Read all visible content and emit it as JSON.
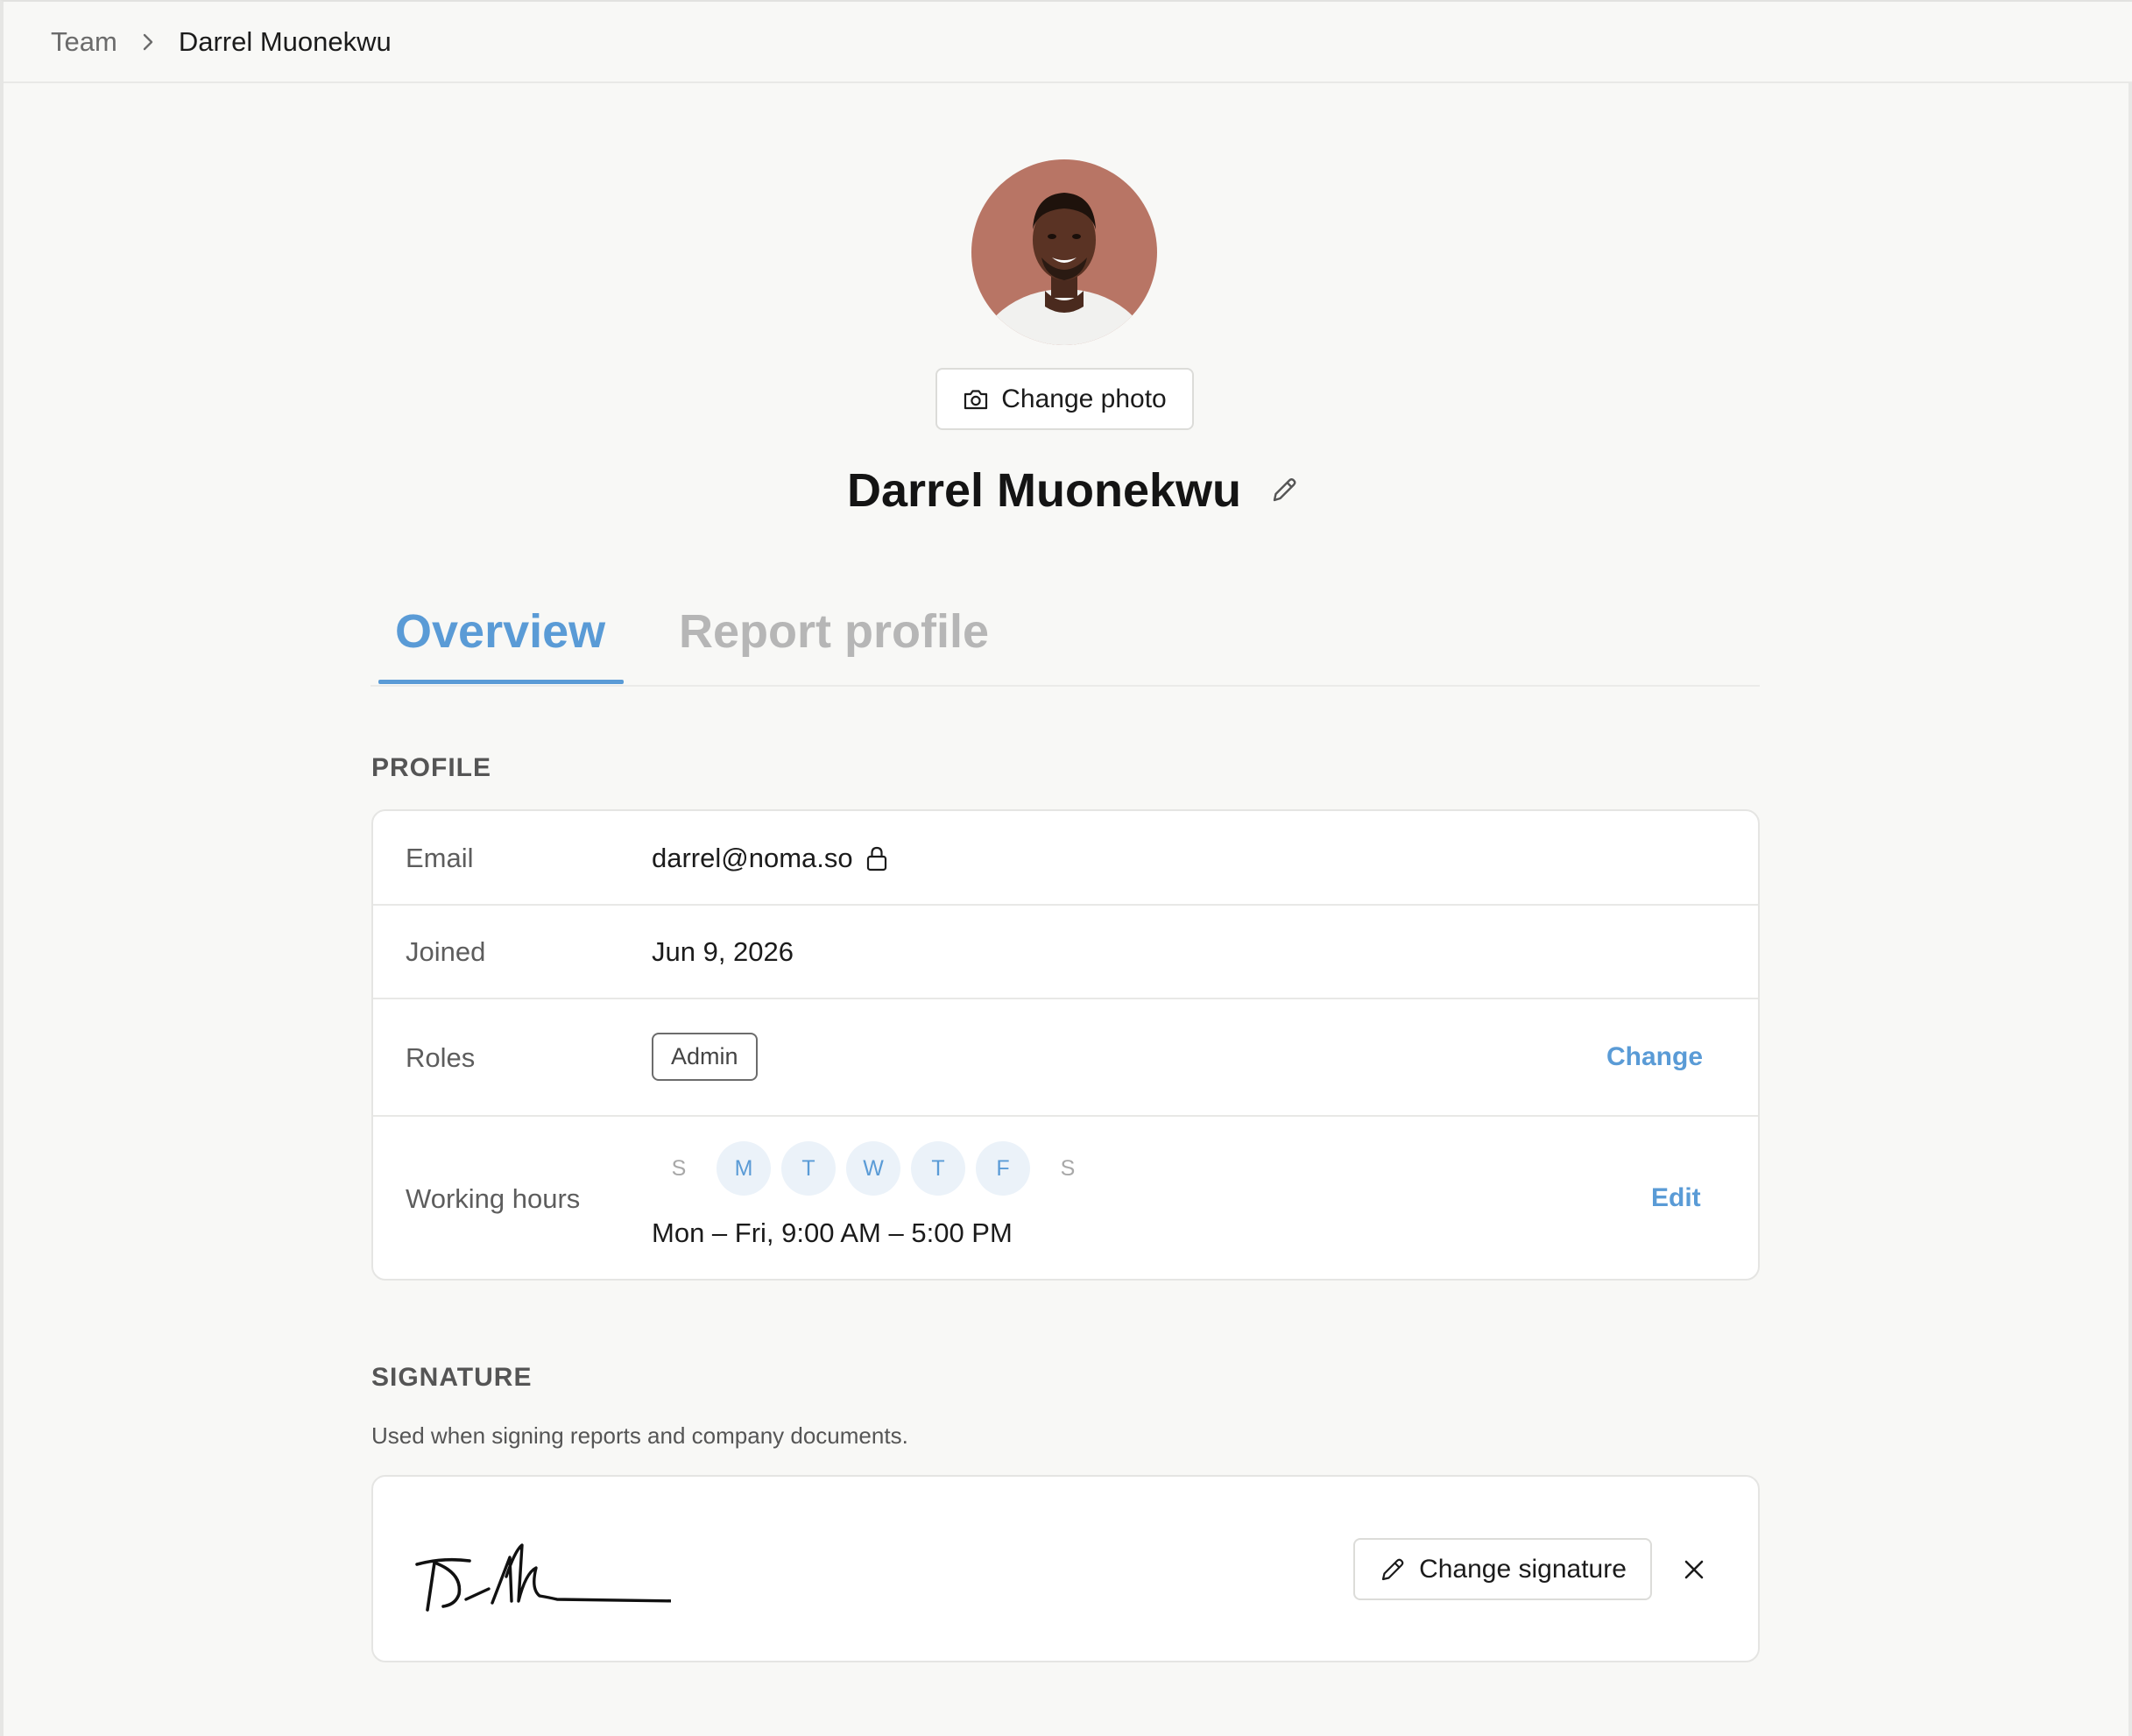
{
  "breadcrumb": {
    "parent": "Team",
    "current": "Darrel Muonekwu"
  },
  "profile_header": {
    "name": "Darrel Muonekwu",
    "change_photo_label": "Change photo"
  },
  "tabs": [
    {
      "label": "Overview",
      "active": true
    },
    {
      "label": "Report profile",
      "active": false
    }
  ],
  "profile_section": {
    "title": "PROFILE",
    "email": {
      "label": "Email",
      "value": "darrel@noma.so"
    },
    "joined": {
      "label": "Joined",
      "value": "Jun 9, 2026"
    },
    "roles": {
      "label": "Roles",
      "badge": "Admin",
      "action": "Change"
    },
    "working_hours": {
      "label": "Working hours",
      "days": [
        {
          "letter": "S",
          "active": false
        },
        {
          "letter": "M",
          "active": true
        },
        {
          "letter": "T",
          "active": true
        },
        {
          "letter": "W",
          "active": true
        },
        {
          "letter": "T",
          "active": true
        },
        {
          "letter": "F",
          "active": true
        },
        {
          "letter": "S",
          "active": false
        }
      ],
      "summary": "Mon – Fri, 9:00 AM – 5:00 PM",
      "action": "Edit"
    }
  },
  "signature_section": {
    "title": "SIGNATURE",
    "description": "Used when signing reports and company documents.",
    "change_label": "Change signature"
  },
  "colors": {
    "accent": "#5a9bd6",
    "avatar_bg": "#b87565"
  },
  "icons": {
    "breadcrumb_sep": "chevron-right-icon",
    "photo": "camera-icon",
    "edit_name": "pencil-icon",
    "email_lock": "lock-icon",
    "signature_edit": "pencil-icon",
    "remove": "close-icon"
  }
}
